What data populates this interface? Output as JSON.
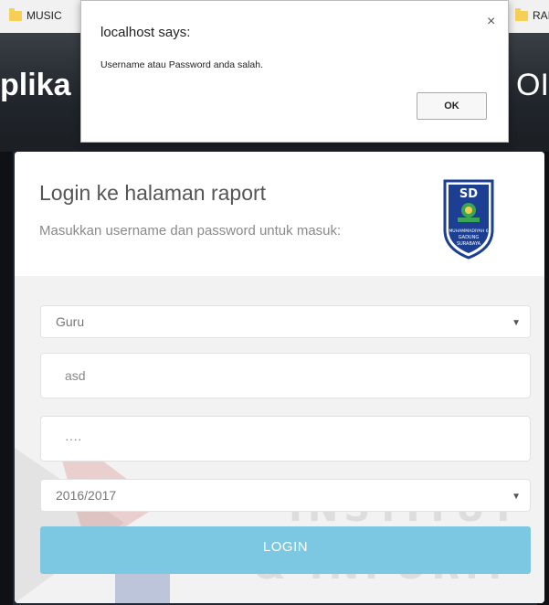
{
  "browser": {
    "bookmarks": [
      {
        "label": "MUSIC",
        "icon": "folder-icon"
      },
      {
        "label": "RAI",
        "icon": "folder-icon"
      }
    ]
  },
  "app": {
    "title_left": "plika",
    "title_right": "OI"
  },
  "alert": {
    "title": "localhost says:",
    "message": "Username atau Password anda salah.",
    "close_glyph": "×",
    "ok_label": "OK"
  },
  "login": {
    "heading": "Login ke halaman raport",
    "subheading": "Masukkan username dan password untuk masuk:",
    "logo": {
      "top": "SD",
      "arc": "MUHAMMADIYAH 6",
      "line1": "GADUNG",
      "line2": "SURABAYA"
    },
    "role_select": {
      "value": "Guru"
    },
    "username_field": {
      "value": "asd"
    },
    "password_field": {
      "value": "····"
    },
    "year_select": {
      "value": "2016/2017"
    },
    "login_button": "LOGIN"
  },
  "watermark": {
    "line1": "INSTITUT",
    "line2": "& INFORM"
  },
  "colors": {
    "accent": "#7cc8e2",
    "bookmark_folder": "#f6cf57",
    "watermark_red": "#c0392b"
  }
}
